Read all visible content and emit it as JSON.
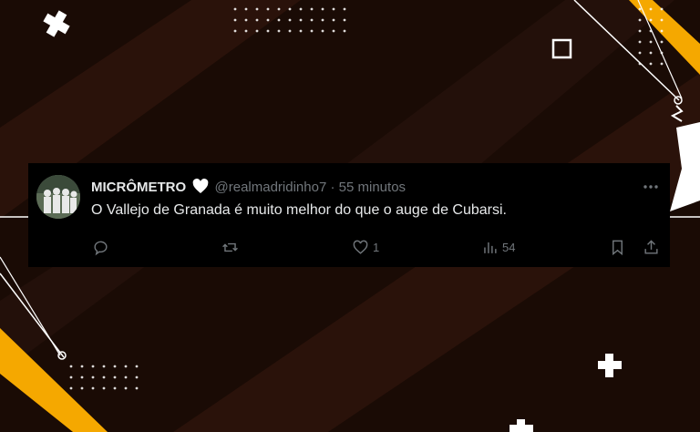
{
  "tweet": {
    "display_name": "MICRÔMETRO",
    "handle": "@realmadridinho7",
    "separator": "·",
    "time": "55 minutos",
    "text": "O Vallejo de Granada é muito melhor do que o auge de Cubarsi.",
    "likes": "1",
    "views": "54"
  },
  "icons": {
    "heart_badge": "white-heart-icon",
    "more": "more-dots-icon",
    "reply": "reply-icon",
    "retweet": "retweet-icon",
    "like": "like-icon",
    "views": "views-icon",
    "bookmark": "bookmark-icon",
    "share": "share-icon"
  },
  "colors": {
    "background": "#1a0b05",
    "accent": "#f5a800",
    "stripe": "#2a120a",
    "text_primary": "#e7e9ea",
    "text_secondary": "#71767b"
  }
}
